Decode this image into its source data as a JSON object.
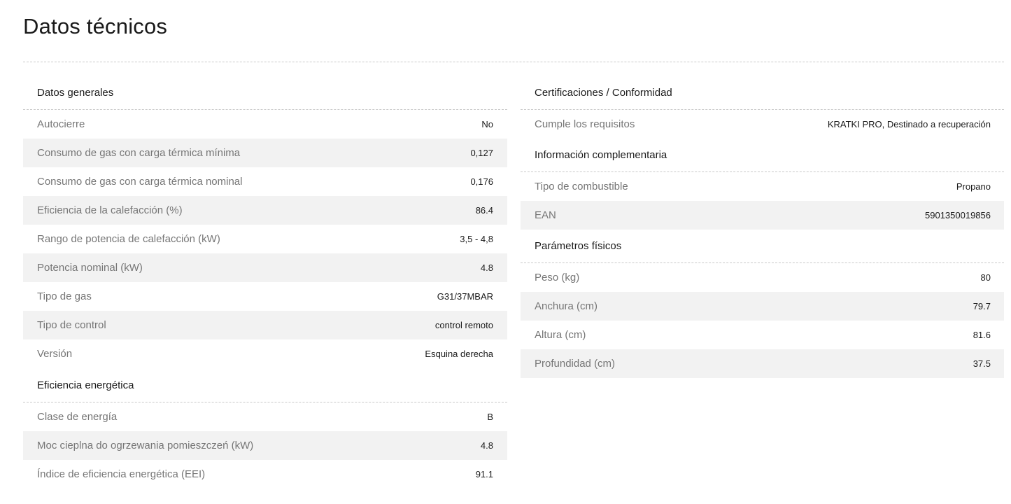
{
  "page": {
    "title": "Datos técnicos"
  },
  "left_sections": [
    {
      "title": "Datos generales",
      "rows": [
        {
          "label": "Autocierre",
          "value": "No"
        },
        {
          "label": "Consumo de gas con carga térmica mínima",
          "value": "0,127"
        },
        {
          "label": "Consumo de gas con carga térmica nominal",
          "value": "0,176"
        },
        {
          "label": "Eficiencia de la calefacción (%)",
          "value": "86.4"
        },
        {
          "label": "Rango de potencia de calefacción (kW)",
          "value": "3,5 - 4,8"
        },
        {
          "label": "Potencia nominal (kW)",
          "value": "4.8"
        },
        {
          "label": "Tipo de gas",
          "value": "G31/37MBAR"
        },
        {
          "label": "Tipo de control",
          "value": "control remoto"
        },
        {
          "label": "Versión",
          "value": "Esquina derecha"
        }
      ]
    },
    {
      "title": "Eficiencia energética",
      "rows": [
        {
          "label": "Clase de energía",
          "value": "B"
        },
        {
          "label": "Moc cieplna do ogrzewania pomieszczeń (kW)",
          "value": "4.8"
        },
        {
          "label": "Índice de eficiencia energética (EEI)",
          "value": "91.1"
        }
      ]
    }
  ],
  "right_sections": [
    {
      "title": "Certificaciones / Conformidad",
      "rows": [
        {
          "label": "Cumple los requisitos",
          "value": "KRATKI PRO, Destinado a recuperación"
        }
      ]
    },
    {
      "title": "Información complementaria",
      "rows": [
        {
          "label": "Tipo de combustible",
          "value": "Propano"
        },
        {
          "label": "EAN",
          "value": "5901350019856"
        }
      ]
    },
    {
      "title": "Parámetros físicos",
      "rows": [
        {
          "label": "Peso (kg)",
          "value": "80"
        },
        {
          "label": "Anchura (cm)",
          "value": "79.7"
        },
        {
          "label": "Altura (cm)",
          "value": "81.6"
        },
        {
          "label": "Profundidad (cm)",
          "value": "37.5"
        }
      ]
    }
  ],
  "colors": {
    "row_alt_background": "#f2f2f2",
    "label_text": "#767676",
    "value_text": "#1a1a1a",
    "divider": "#c9c9c9"
  }
}
